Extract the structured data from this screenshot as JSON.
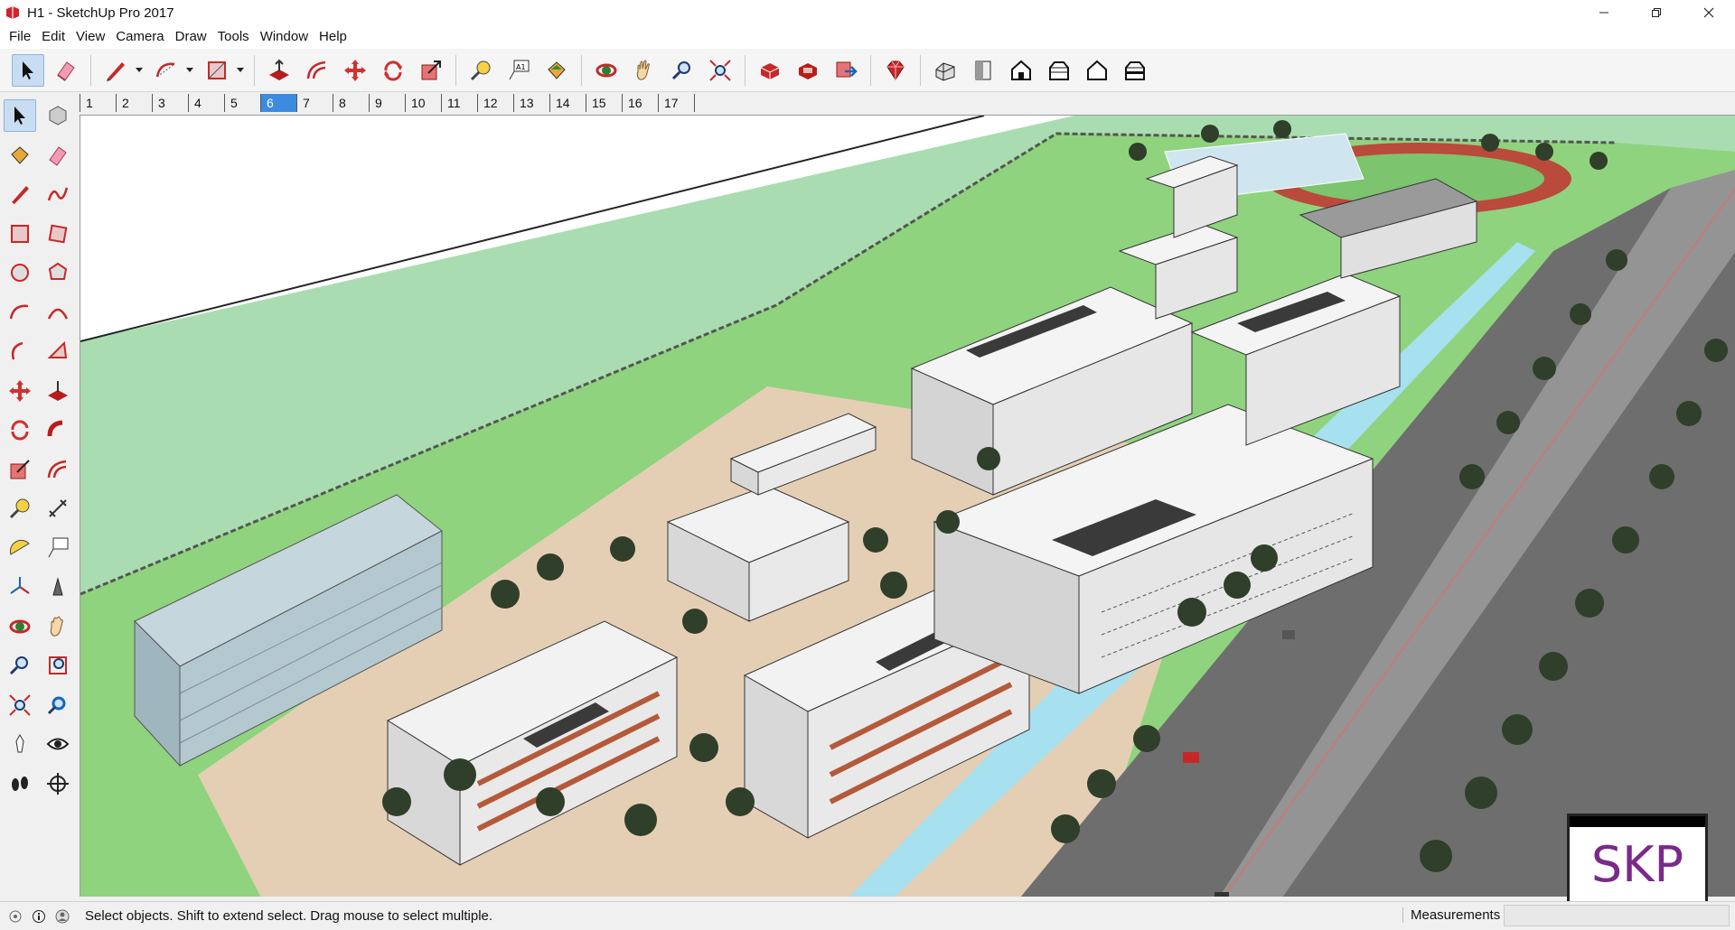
{
  "window": {
    "title": "H1 - SketchUp Pro 2017"
  },
  "menu": [
    "File",
    "Edit",
    "View",
    "Camera",
    "Draw",
    "Tools",
    "Window",
    "Help"
  ],
  "toolbar": [
    {
      "name": "select-tool",
      "icon": "arrow-cursor-icon",
      "active": true
    },
    {
      "name": "eraser-tool",
      "icon": "eraser-icon"
    },
    {
      "name": "line-tool",
      "icon": "pencil-icon",
      "dropdown": true
    },
    {
      "name": "arc-tool",
      "icon": "arc-icon",
      "dropdown": true
    },
    {
      "name": "shape-tool",
      "icon": "rectangle-icon",
      "dropdown": true
    },
    {
      "name": "push-pull-tool",
      "icon": "push-pull-icon"
    },
    {
      "name": "offset-tool",
      "icon": "offset-icon"
    },
    {
      "name": "move-tool",
      "icon": "move-icon"
    },
    {
      "name": "rotate-tool",
      "icon": "rotate-icon"
    },
    {
      "name": "scale-tool",
      "icon": "scale-icon"
    },
    {
      "name": "tape-measure-tool",
      "icon": "tape-measure-icon"
    },
    {
      "name": "text-tool",
      "icon": "text-label-icon"
    },
    {
      "name": "paint-bucket-tool",
      "icon": "paint-bucket-icon"
    },
    {
      "name": "orbit-tool",
      "icon": "orbit-icon"
    },
    {
      "name": "pan-tool",
      "icon": "hand-icon"
    },
    {
      "name": "zoom-tool",
      "icon": "magnifier-icon"
    },
    {
      "name": "zoom-extents-tool",
      "icon": "zoom-extents-icon"
    },
    {
      "name": "3d-warehouse-button",
      "icon": "warehouse-icon"
    },
    {
      "name": "extension-warehouse-button",
      "icon": "extension-icon"
    },
    {
      "name": "send-to-layout-button",
      "icon": "layout-icon"
    },
    {
      "name": "extension-manager-button",
      "icon": "ruby-gem-icon"
    },
    {
      "name": "iso-view-button",
      "icon": "iso-house-icon"
    },
    {
      "name": "top-view-button",
      "icon": "top-view-icon"
    },
    {
      "name": "front-view-button",
      "icon": "front-view-icon"
    },
    {
      "name": "right-view-button",
      "icon": "right-view-icon"
    },
    {
      "name": "back-view-button",
      "icon": "back-view-icon"
    },
    {
      "name": "left-view-button",
      "icon": "left-view-icon"
    }
  ],
  "scenes": [
    "1",
    "2",
    "3",
    "4",
    "5",
    "6",
    "7",
    "8",
    "9",
    "10",
    "11",
    "12",
    "13",
    "14",
    "15",
    "16",
    "17"
  ],
  "active_scene": "6",
  "palette": [
    [
      "select-icon",
      "component-icon"
    ],
    [
      "paint-bucket-icon",
      "eraser-icon"
    ],
    [
      "line-icon",
      "freehand-icon"
    ],
    [
      "rectangle-icon",
      "rotated-rectangle-icon"
    ],
    [
      "circle-icon",
      "polygon-icon"
    ],
    [
      "arc-icon",
      "two-point-arc-icon"
    ],
    [
      "three-point-arc-icon",
      "pie-icon"
    ],
    [
      "move-icon",
      "push-pull-icon"
    ],
    [
      "rotate-icon",
      "follow-me-icon"
    ],
    [
      "scale-icon",
      "offset-icon"
    ],
    [
      "tape-measure-icon",
      "dimension-icon"
    ],
    [
      "protractor-icon",
      "text-icon"
    ],
    [
      "axes-icon",
      "3d-text-icon"
    ],
    [
      "orbit-icon",
      "pan-icon"
    ],
    [
      "zoom-icon",
      "zoom-window-icon"
    ],
    [
      "zoom-extents-icon",
      "previous-view-icon"
    ],
    [
      "position-camera-icon",
      "look-around-icon"
    ],
    [
      "walk-icon",
      "section-plane-icon"
    ]
  ],
  "status": {
    "text": "Select objects. Shift to extend select. Drag mouse to select multiple.",
    "measurements_label": "Measurements",
    "measurements_value": ""
  },
  "watermark": "SKP",
  "colors": {
    "accent": "#3c8be0",
    "ground": "#a8dcae",
    "road": "#6e6e6e",
    "lawn": "#8fd37e"
  }
}
